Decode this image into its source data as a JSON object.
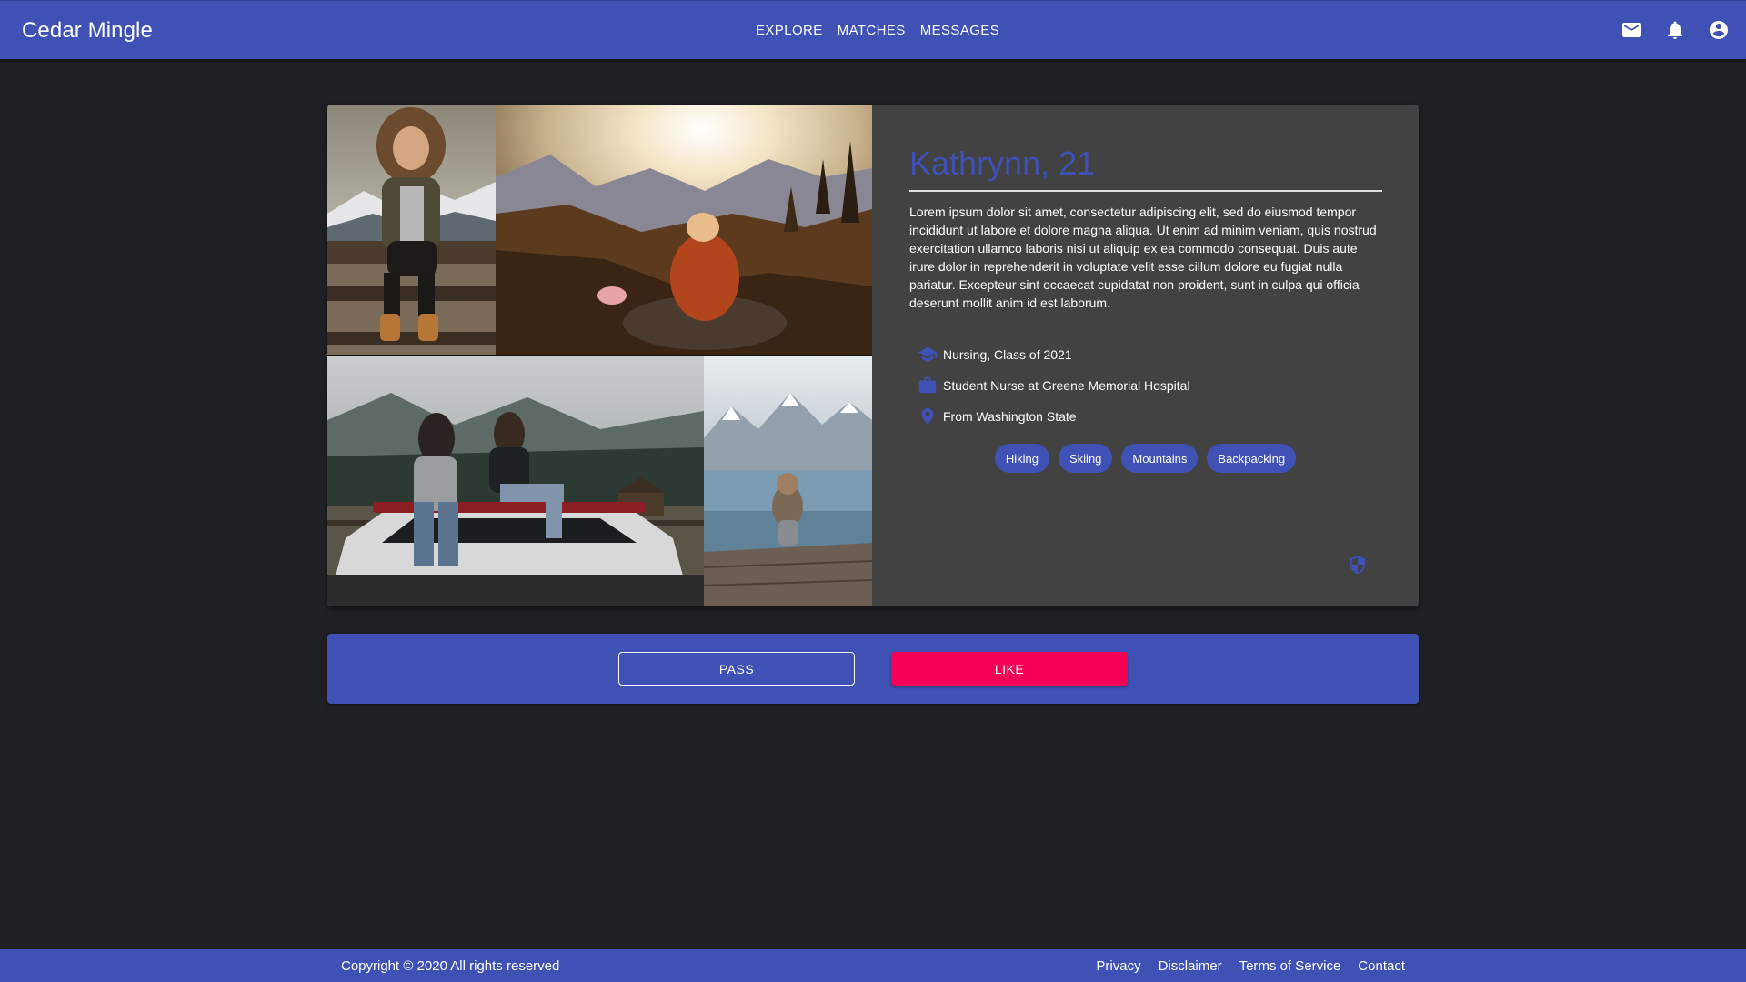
{
  "app": {
    "brand": "Cedar Mingle"
  },
  "nav": {
    "items": [
      "EXPLORE",
      "MATCHES",
      "MESSAGES"
    ]
  },
  "top_icons": [
    "mail-icon",
    "bell-icon",
    "account-circle-icon"
  ],
  "photos": [
    {
      "icon": "photo-woman-fur-hood"
    },
    {
      "icon": "photo-mountain-sunset"
    },
    {
      "icon": "photo-friends-on-car"
    },
    {
      "icon": "photo-lake-dock"
    }
  ],
  "profile": {
    "name": "Kathrynn, 21",
    "bio": "Lorem ipsum dolor sit amet, consectetur adipiscing elit, sed do eiusmod tempor incididunt ut labore et dolore magna aliqua. Ut enim ad minim veniam, quis nostrud exercitation ullamco laboris nisi ut aliquip ex ea commodo consequat. Duis aute irure dolor in reprehenderit in voluptate velit esse cillum dolore eu fugiat nulla pariatur. Excepteur sint occaecat cupidatat non proident, sunt in culpa qui officia deserunt mollit anim id est laborum.",
    "facts": [
      {
        "icon": "graduation-cap-icon",
        "text": "Nursing, Class of 2021"
      },
      {
        "icon": "briefcase-icon",
        "text": "Student Nurse at Greene Memorial Hospital"
      },
      {
        "icon": "location-pin-icon",
        "text": "From Washington State"
      }
    ],
    "interests": [
      "Hiking",
      "Skiing",
      "Mountains",
      "Backpacking"
    ],
    "report_icon": "shield-icon"
  },
  "actions": {
    "pass_label": "PASS",
    "like_label": "LIKE"
  },
  "colors": {
    "primary": "#3f51b5",
    "accent": "#f50057",
    "background": "#1f2023",
    "card": "#424242"
  },
  "footer": {
    "copyright": "Copyright © 2020 All rights reserved",
    "links": [
      "Privacy",
      "Disclaimer",
      "Terms of Service",
      "Contact"
    ]
  }
}
